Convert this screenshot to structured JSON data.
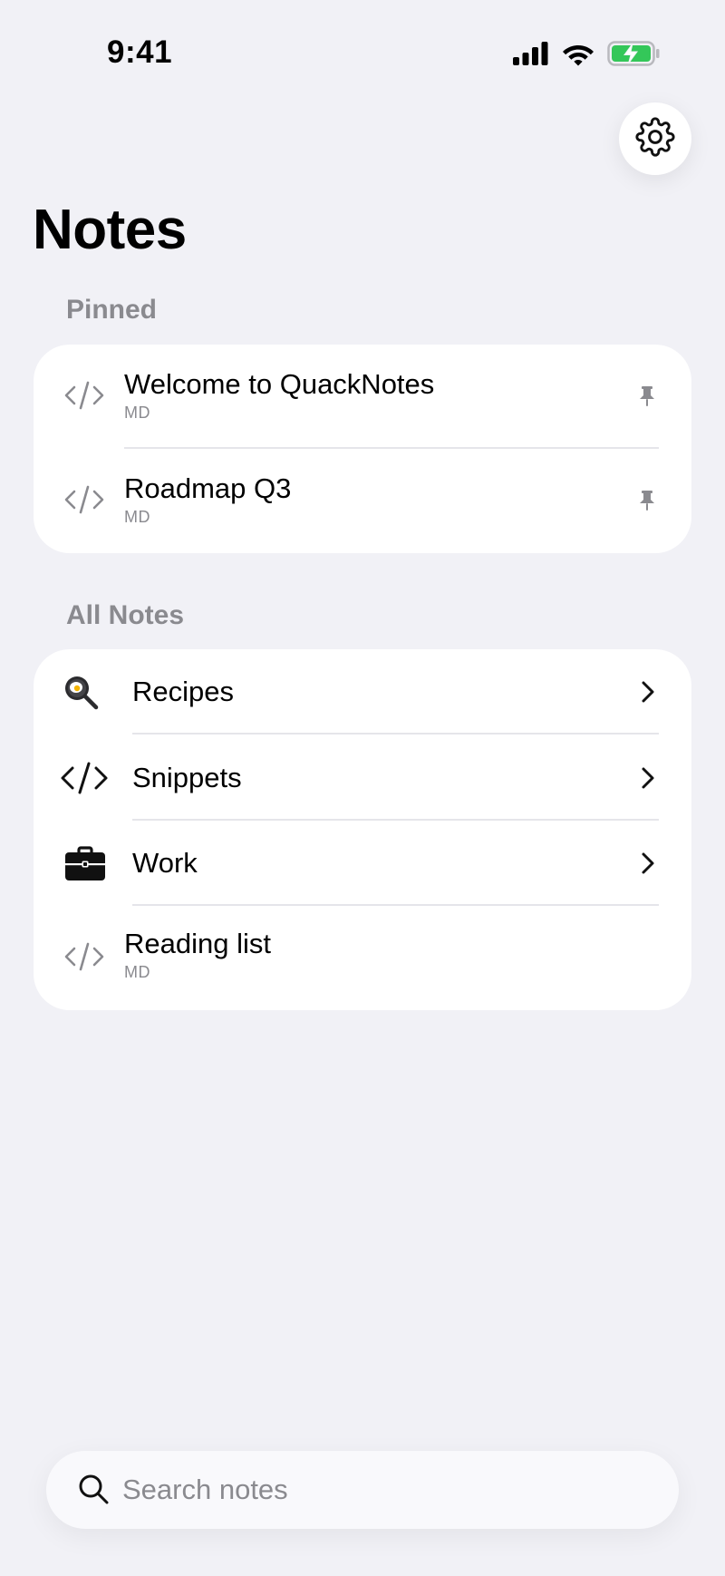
{
  "status_bar": {
    "time": "9:41",
    "icons": [
      "cellular-signal-icon",
      "wifi-icon",
      "battery-charging-icon"
    ],
    "battery_color": "#34c759"
  },
  "header": {
    "settings_icon": "gear-icon",
    "title": "Notes"
  },
  "pinned": {
    "label": "Pinned",
    "items": [
      {
        "title": "Welcome to QuackNotes",
        "subtitle": "MD",
        "icon": "code-icon",
        "trailing": "pin-icon"
      },
      {
        "title": "Roadmap Q3",
        "subtitle": "MD",
        "icon": "code-icon",
        "trailing": "pin-icon"
      }
    ]
  },
  "all_notes": {
    "label": "All Notes",
    "items": [
      {
        "title": "Recipes",
        "icon": "frying-pan-icon",
        "trailing": "chevron-right-icon"
      },
      {
        "title": "Snippets",
        "icon": "code-icon",
        "trailing": "chevron-right-icon"
      },
      {
        "title": "Work",
        "icon": "briefcase-icon",
        "trailing": "chevron-right-icon"
      },
      {
        "title": "Reading list",
        "subtitle": "MD",
        "icon": "code-icon"
      }
    ]
  },
  "search": {
    "placeholder": "Search notes",
    "value": ""
  }
}
